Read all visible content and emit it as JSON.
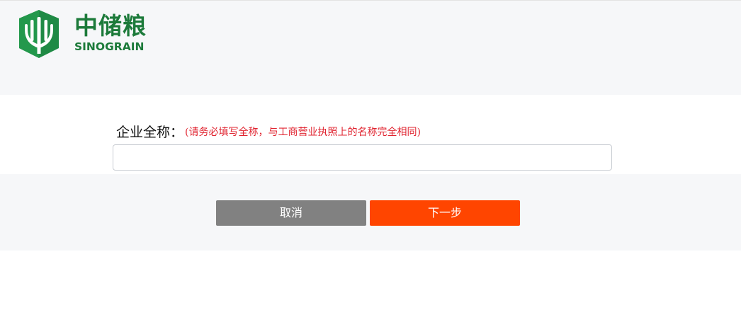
{
  "header": {
    "logo": {
      "chinese_name": "中储粮",
      "english_name": "SINOGRAIN",
      "brand_color": "#1c7a3a"
    }
  },
  "form": {
    "company_name": {
      "label": "企业全称：",
      "hint": "(请务必填写全称，与工商营业执照上的名称完全相同)",
      "value": "",
      "placeholder": ""
    }
  },
  "actions": {
    "cancel_label": "取消",
    "next_label": "下一步",
    "cancel_color": "#818181",
    "next_color": "#ff4500"
  }
}
